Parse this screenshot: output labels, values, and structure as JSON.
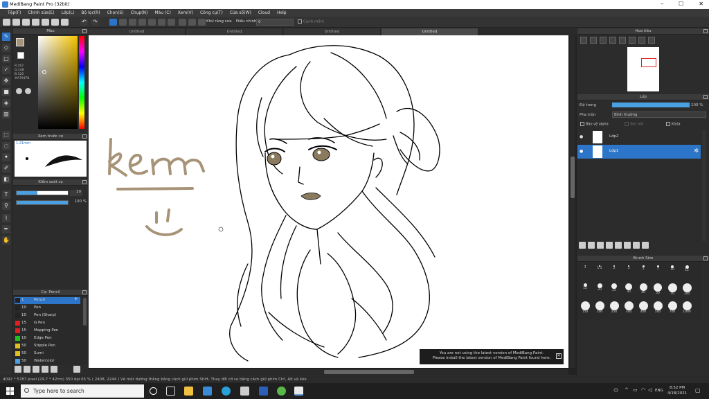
{
  "window": {
    "title": "MediBang Paint Pro (32bit)"
  },
  "menu": [
    "Tệp(F)",
    "Chỉnh sửa(E)",
    "Lớp(L)",
    "Bộ lọc(R)",
    "Chọn(S)",
    "Chụp(N)",
    "Màu (C)",
    "Xem(V)",
    "Công cụ(T)",
    "Cửa sổ(W)",
    "Cloud",
    "Help"
  ],
  "toolbar": {
    "antialias_label": "Khử răng cưa",
    "correction_label": "Điều chỉnh",
    "correction_value": "0",
    "snap_label": "Cạnh mềm"
  },
  "tabs": [
    "Untitled",
    "Untitled",
    "Untitled",
    "Untitled"
  ],
  "color_panel": {
    "title": "Màu",
    "r": "R:167",
    "g": "G:148",
    "b": "B:120",
    "hex": "#A79478"
  },
  "brush_preview": {
    "title": "Xem trước cọ",
    "size": "1.21mm"
  },
  "brush_control": {
    "title": "Kiểm soát cọ",
    "size_value": "10",
    "opacity_value": "100 %"
  },
  "brush_list": {
    "title": "Cọ: Pencil",
    "items": [
      {
        "size": "1",
        "name": "Pencil",
        "color": "#222222"
      },
      {
        "size": "10",
        "name": "Pen",
        "color": "#222222"
      },
      {
        "size": "10",
        "name": "Pen (Sharp)",
        "color": "#222222"
      },
      {
        "size": "15",
        "name": "G Pen",
        "color": "#e02020"
      },
      {
        "size": "15",
        "name": "Mapping Pen",
        "color": "#e02020"
      },
      {
        "size": "10",
        "name": "Edge Pen",
        "color": "#20c020"
      },
      {
        "size": "50",
        "name": "Stipple Pen",
        "color": "#e0c020"
      },
      {
        "size": "50",
        "name": "Sumi",
        "color": "#e0c020"
      },
      {
        "size": "50",
        "name": "Watercolor",
        "color": "#4aa0e0"
      }
    ]
  },
  "navigator": {
    "title": "Hoa tiêu"
  },
  "layers": {
    "title": "Lớp",
    "opacity_label": "Độ trong",
    "opacity_value": "100 %",
    "blend_label": "Pha trộn",
    "blend_value": "Bình thường",
    "protect_alpha": "Bảo vệ alpha",
    "clipping": "Xén bớt",
    "lock": "Khóa",
    "items": [
      "Lớp2",
      "Lớp1"
    ]
  },
  "brush_size": {
    "title": "Brush Size",
    "sizes": [
      "1",
      "1.5",
      "2",
      "3",
      "5",
      "7",
      "10",
      "12",
      "15",
      "20",
      "25",
      "30",
      "40",
      "50",
      "70",
      "100",
      "150",
      "200",
      "250",
      "300",
      "400",
      "500",
      "700",
      "1000"
    ]
  },
  "notice": {
    "line1": "You are not using the latest version of MediBang Paint.",
    "line2": "Please install the latest version of MediBang Paint found here."
  },
  "status": "4092 * 5787 pixel  (29.7 * 42cm)  350 dpi  65 %  ( 2408, 2244 )  Vẽ một đường thẳng bằng cách giữ phím Shift, Thay đổi cỡ cọ bằng cách giữ phím Ctrl, Alt và kéo",
  "taskbar": {
    "search_placeholder": "Type here to search",
    "lang": "ENG",
    "time": "8:52 PM",
    "date": "4/18/2021"
  },
  "colors": {
    "accent": "#2d75c8",
    "sketch_brown": "#A79478"
  }
}
